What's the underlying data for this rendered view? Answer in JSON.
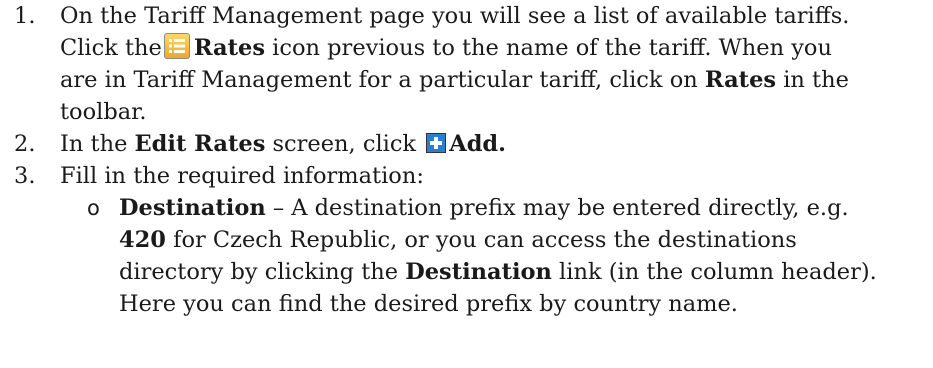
{
  "step1": {
    "number": "1.",
    "line1": "On the Tariff Management page you will see a list of available tariffs.",
    "line2_a": "Click the",
    "rates_word": "Rates",
    "line2_b": " icon previous to the name of the tariff. When you",
    "line3_a": "are in Tariff Management for a particular tariff, click on ",
    "rates_word_2": "Rates",
    "line3_b": " in the",
    "line4": "toolbar."
  },
  "step2": {
    "number": "2.",
    "text_a": "In the ",
    "edit_rates": "Edit Rates",
    "text_b": " screen, click ",
    "add": "Add."
  },
  "step3": {
    "number": "3.",
    "text": "Fill in the required information:"
  },
  "bullet1": {
    "marker": "o",
    "term": "Destination",
    "line1_rest": " – A destination prefix may be entered directly, e.g.",
    "code": "420",
    "line2_rest": " for Czech Republic, or you can access the destinations",
    "line3_a": "directory by clicking the ",
    "destination_link": "Destination",
    "line3_b": " link (in the column header).",
    "line4": "Here you can find the desired prefix by country name."
  },
  "icons": [
    "rates-icon",
    "add-icon"
  ]
}
